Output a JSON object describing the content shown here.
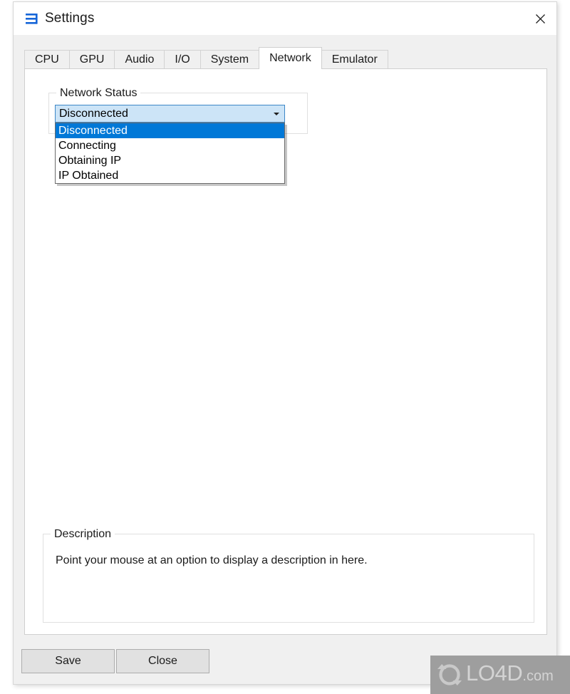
{
  "window": {
    "title": "Settings",
    "icon": "app-logo-icon",
    "close_label": "✕"
  },
  "tabs": [
    {
      "label": "CPU",
      "active": false
    },
    {
      "label": "GPU",
      "active": false
    },
    {
      "label": "Audio",
      "active": false
    },
    {
      "label": "I/O",
      "active": false
    },
    {
      "label": "System",
      "active": false
    },
    {
      "label": "Network",
      "active": true
    },
    {
      "label": "Emulator",
      "active": false
    }
  ],
  "network_status": {
    "group_label": "Network Status",
    "combo": {
      "value": "Disconnected",
      "expanded": true,
      "options": [
        {
          "label": "Disconnected",
          "selected": true
        },
        {
          "label": "Connecting",
          "selected": false
        },
        {
          "label": "Obtaining IP",
          "selected": false
        },
        {
          "label": "IP Obtained",
          "selected": false
        }
      ]
    }
  },
  "description": {
    "group_label": "Description",
    "text": "Point your mouse at an option to display a description in here."
  },
  "footer": {
    "save_label": "Save",
    "close_label": "Close"
  },
  "watermark": {
    "name": "LO4D",
    "suffix": ".com"
  },
  "colors": {
    "accent": "#0078d7",
    "combo_fill": "#cce4f7",
    "combo_border": "#3d87c7",
    "window_bg": "#f0f0f0",
    "panel_bg": "#ffffff",
    "button_bg": "#e1e1e1",
    "watermark_bg": "#9e9e9e"
  }
}
